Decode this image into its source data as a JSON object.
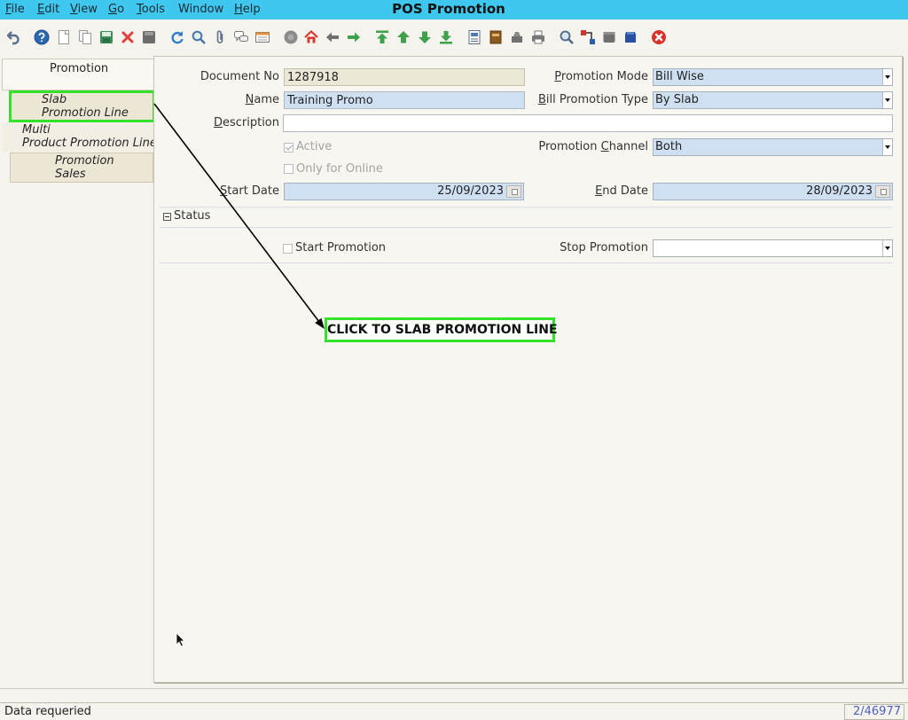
{
  "window": {
    "title": "POS Promotion"
  },
  "menu": [
    "File",
    "Edit",
    "View",
    "Go",
    "Tools",
    "Window",
    "Help"
  ],
  "toolbar": {
    "icons": [
      "undo-icon",
      "help-icon",
      "new-record-icon",
      "copy-record-icon",
      "save-icon",
      "delete-icon",
      "save-disabled-icon",
      "refresh-icon",
      "find-icon",
      "attachment-icon",
      "chat-icon",
      "history-icon",
      "archive-icon",
      "home-icon",
      "back-icon",
      "forward-icon",
      "first-record-icon",
      "previous-record-icon",
      "next-record-icon",
      "last-record-icon",
      "report-icon",
      "archived-documents-icon",
      "product-info-icon",
      "print-icon",
      "zoom-across-icon",
      "workflow-icon",
      "request-icon",
      "product-icon",
      "close-window-icon"
    ]
  },
  "tabs": [
    {
      "lines": [
        "Promotion"
      ]
    },
    {
      "lines": [
        "Slab",
        "Promotion Line"
      ]
    },
    {
      "lines": [
        "Multi",
        "Product Promotion Line"
      ]
    },
    {
      "lines": [
        "Promotion",
        "Sales"
      ]
    }
  ],
  "form": {
    "document_no": {
      "label": "Document No",
      "value": "1287918"
    },
    "name": {
      "label": "Name",
      "value": "Training Promo"
    },
    "description": {
      "label": "Description",
      "value": ""
    },
    "active": {
      "label": "Active",
      "checked": true
    },
    "only_online": {
      "label": "Only for Online",
      "checked": false
    },
    "start_date": {
      "label": "Start Date",
      "value": "25/09/2023"
    },
    "promotion_mode": {
      "label": "Promotion Mode",
      "value": "Bill Wise"
    },
    "bill_promotion_type": {
      "label": "Bill Promotion Type",
      "value": "By Slab"
    },
    "promotion_channel": {
      "label_1": "Promotion",
      "label_2": "Channel",
      "value": "Both"
    },
    "end_date": {
      "label": "End Date",
      "value": "28/09/2023"
    }
  },
  "status_section": {
    "title": "Status",
    "start_promotion": {
      "label": "Start Promotion",
      "checked": false
    },
    "stop_promotion": {
      "label": "Stop Promotion",
      "value": ""
    }
  },
  "annotation": {
    "text": "CLICK TO SLAB PROMOTION LINE"
  },
  "statusbar": {
    "message": "Data requeried",
    "record": "2/46977"
  },
  "colors": {
    "menubar": "#3fc8ef",
    "mandatory_field": "#cfe0f2",
    "readonly_field": "#ebe8d8",
    "annotation_green": "#33e02a",
    "record_counter": "#4a5fc2"
  }
}
